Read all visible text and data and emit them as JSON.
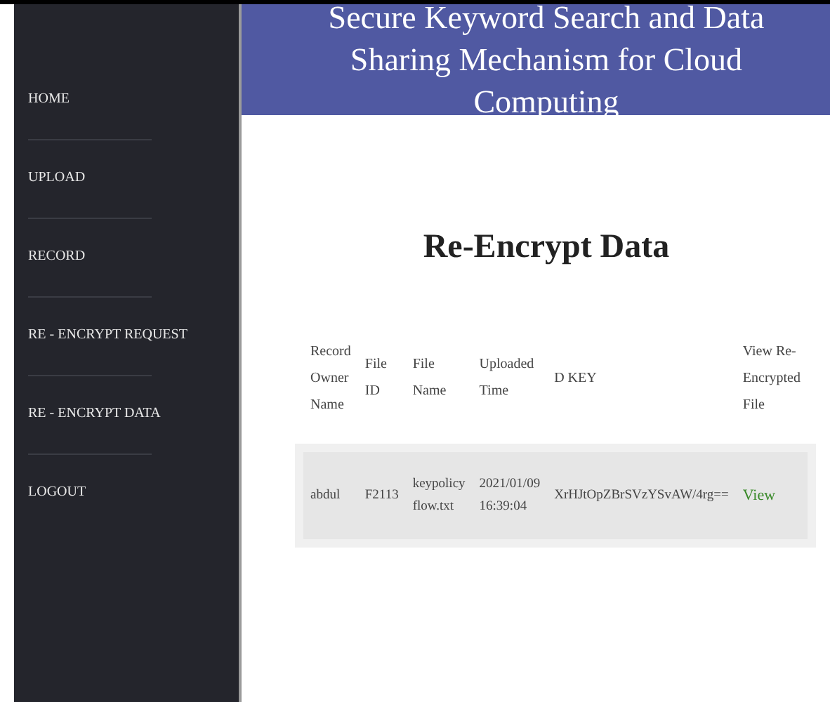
{
  "sidebar": {
    "items": [
      {
        "label": "HOME"
      },
      {
        "label": "UPLOAD"
      },
      {
        "label": "RECORD"
      },
      {
        "label": "RE - ENCRYPT REQUEST"
      },
      {
        "label": "RE - ENCRYPT DATA"
      },
      {
        "label": "LOGOUT"
      }
    ]
  },
  "header": {
    "title": "Secure Keyword Search and Data Sharing Mechanism for Cloud Computing"
  },
  "page_title": "Re-Encrypt Data",
  "table": {
    "columns": [
      "Record Owner Name",
      "File ID",
      "File Name",
      "Uploaded Time",
      "D KEY",
      "View Re-Encrypted File"
    ],
    "rows": [
      {
        "cells": [
          "abdul",
          "F2113",
          "keypolicy flow.txt",
          "2021/01/09 16:39:04",
          "XrHJtOpZBrSVzYSvAW/4rg=="
        ],
        "link": "View"
      }
    ]
  }
}
